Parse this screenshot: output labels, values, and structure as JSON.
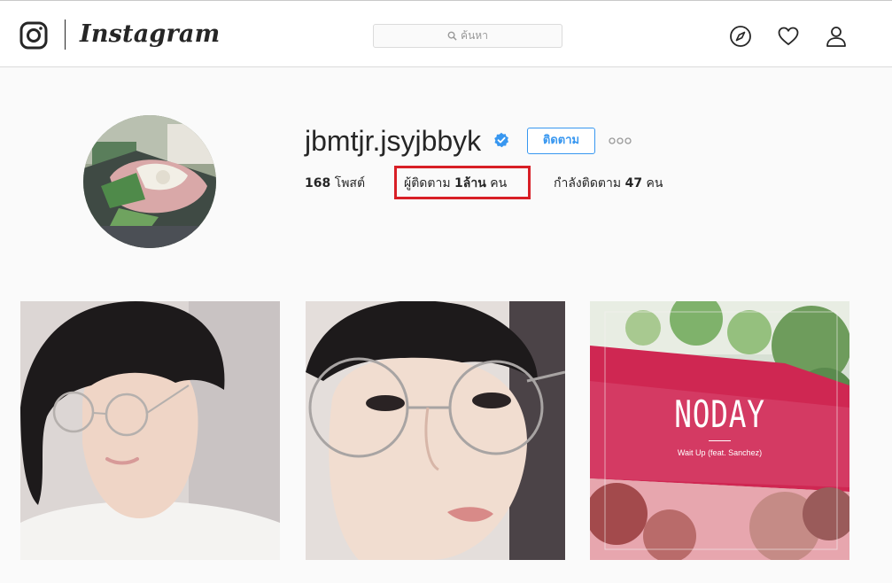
{
  "app": {
    "brand": "Instagram"
  },
  "header": {
    "search_placeholder": "ค้นหา",
    "icons": [
      "compass-icon",
      "heart-icon",
      "person-icon"
    ]
  },
  "profile": {
    "username": "jbmtjr.jsyjbbyk",
    "verified": true,
    "follow_label": "ติดตาม",
    "stats": {
      "posts_count": "168",
      "posts_label": "โพสต์",
      "followers_label": "ผู้ติดตาม",
      "followers_count": "1ล้าน",
      "followers_unit": "คน",
      "following_label": "กำลังติดตาม",
      "following_count": "47",
      "following_unit": "คน"
    }
  },
  "posts": [
    {
      "type": "photo"
    },
    {
      "type": "photo"
    },
    {
      "type": "album-art",
      "title": "NODAY",
      "subtitle": "Wait Up (feat. Sanchez)"
    }
  ],
  "colors": {
    "accent": "#3897f0",
    "highlight": "#d81f26",
    "background": "#fafafa",
    "text": "#262626"
  }
}
